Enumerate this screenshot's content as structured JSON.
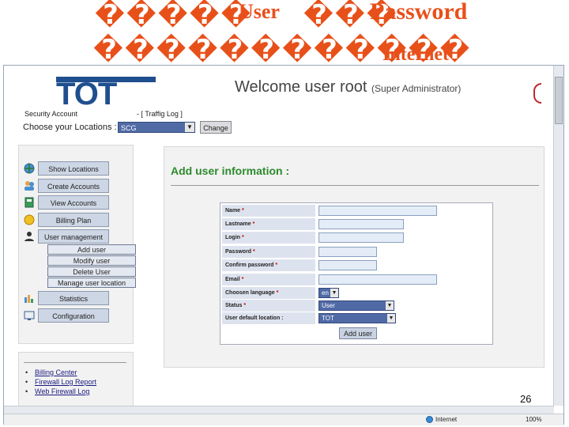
{
  "slide": {
    "title_garbled_row1_count": 5,
    "title_garbled_row2_count": 12,
    "overlay_words": {
      "user": "User",
      "password": "Password",
      "internet": "Internet"
    },
    "page_number": "26"
  },
  "header": {
    "logo_text": "TOT",
    "welcome_text": "Welcome user root",
    "role_text": "(Super Administrator)",
    "security_account": "Security Account",
    "traffic_log": "- [ Traffig Log ]",
    "location_label": "Choose your Locations :",
    "location_value": "SCG",
    "change_label": "Change"
  },
  "sidebar": {
    "menu": [
      {
        "label": "Show Locations",
        "icon": "globe-icon"
      },
      {
        "label": "Create Accounts",
        "icon": "users-icon"
      },
      {
        "label": "View Accounts",
        "icon": "book-icon"
      },
      {
        "label": "Billing Plan",
        "icon": "coins-icon"
      },
      {
        "label": "User management",
        "icon": "person-icon"
      },
      {
        "label": "Statistics",
        "icon": "chart-icon"
      },
      {
        "label": "Configuration",
        "icon": "config-icon"
      }
    ],
    "submenu": [
      "Add user",
      "Modify user",
      "Delete User",
      "Manage user location"
    ],
    "links": [
      "Billing Center",
      "Firewall Log Report",
      "Web Firewall Log"
    ]
  },
  "main": {
    "title": "Add user information :",
    "form": {
      "fields": [
        {
          "label": "Name",
          "required": true
        },
        {
          "label": "Lastname",
          "required": true
        },
        {
          "label": "Login",
          "required": true
        },
        {
          "label": "Password",
          "required": true
        },
        {
          "label": "Confirm password",
          "required": true
        },
        {
          "label": "Email",
          "required": true
        },
        {
          "label": "Choosen language",
          "required": true,
          "value": "en"
        },
        {
          "label": "Status",
          "required": true,
          "value": "User"
        },
        {
          "label": "User default location :",
          "required": false,
          "value": "TOT"
        }
      ],
      "submit_label": "Add user"
    }
  },
  "statusbar": {
    "zone": "Internet",
    "zoom": "100%"
  },
  "colors": {
    "accent": "#e8501a",
    "brand": "#1f4f8f",
    "select_bg": "#506aa6",
    "heading_green": "#2d8a2d"
  }
}
